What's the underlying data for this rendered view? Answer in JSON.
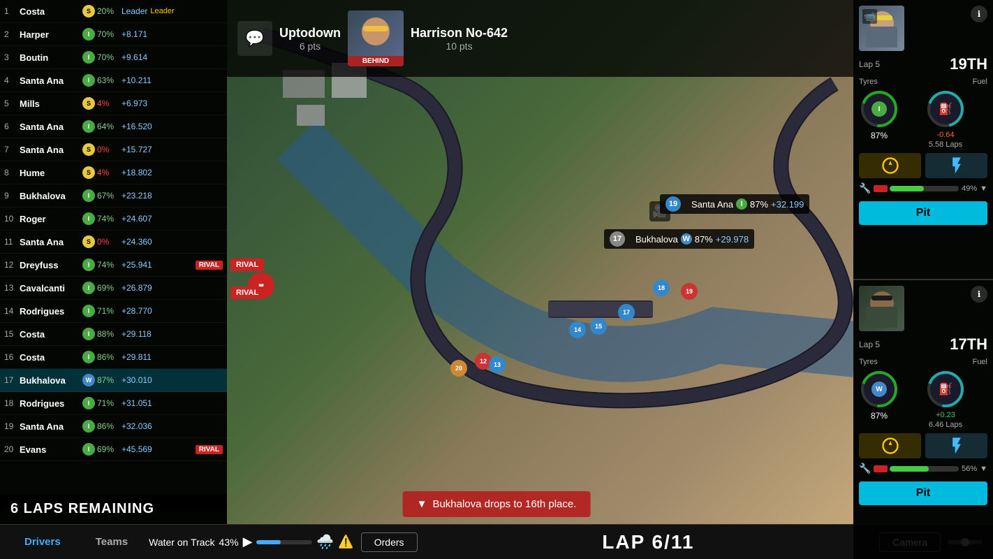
{
  "standings": [
    {
      "pos": 1,
      "name": "Costa",
      "tyre": "S",
      "pct": "20%",
      "gap": "Leader",
      "rival": false,
      "highlight": false
    },
    {
      "pos": 2,
      "name": "Harper",
      "tyre": "I",
      "pct": "70%",
      "gap": "+8.171",
      "rival": false,
      "highlight": false
    },
    {
      "pos": 3,
      "name": "Boutin",
      "tyre": "I",
      "pct": "70%",
      "gap": "+9.614",
      "rival": false,
      "highlight": false
    },
    {
      "pos": 4,
      "name": "Santa Ana",
      "tyre": "I",
      "pct": "63%",
      "gap": "+10.211",
      "rival": false,
      "highlight": false
    },
    {
      "pos": 5,
      "name": "Mills",
      "tyre": "S",
      "pct": "4%",
      "gap": "+6.973",
      "rival": false,
      "highlight": false
    },
    {
      "pos": 6,
      "name": "Santa Ana",
      "tyre": "I",
      "pct": "64%",
      "gap": "+16.520",
      "rival": false,
      "highlight": false
    },
    {
      "pos": 7,
      "name": "Santa Ana",
      "tyre": "S",
      "pct": "0%",
      "gap": "+15.727",
      "rival": false,
      "highlight": false
    },
    {
      "pos": 8,
      "name": "Hume",
      "tyre": "S",
      "pct": "4%",
      "gap": "+18.802",
      "rival": false,
      "highlight": false
    },
    {
      "pos": 9,
      "name": "Bukhalova",
      "tyre": "I",
      "pct": "67%",
      "gap": "+23.218",
      "rival": false,
      "highlight": false
    },
    {
      "pos": 10,
      "name": "Roger",
      "tyre": "I",
      "pct": "74%",
      "gap": "+24.607",
      "rival": false,
      "highlight": false
    },
    {
      "pos": 11,
      "name": "Santa Ana",
      "tyre": "S",
      "pct": "0%",
      "gap": "+24.360",
      "rival": false,
      "highlight": false
    },
    {
      "pos": 12,
      "name": "Dreyfuss",
      "tyre": "I",
      "pct": "74%",
      "gap": "+25.941",
      "rival": true,
      "highlight": false
    },
    {
      "pos": 13,
      "name": "Cavalcanti",
      "tyre": "I",
      "pct": "69%",
      "gap": "+26.879",
      "rival": false,
      "highlight": false
    },
    {
      "pos": 14,
      "name": "Rodrigues",
      "tyre": "I",
      "pct": "71%",
      "gap": "+28.770",
      "rival": false,
      "highlight": false
    },
    {
      "pos": 15,
      "name": "Costa",
      "tyre": "I",
      "pct": "88%",
      "gap": "+29.118",
      "rival": false,
      "highlight": false
    },
    {
      "pos": 16,
      "name": "Costa",
      "tyre": "I",
      "pct": "86%",
      "gap": "+29.811",
      "rival": false,
      "highlight": false
    },
    {
      "pos": 17,
      "name": "Bukhalova",
      "tyre": "W",
      "pct": "87%",
      "gap": "+30.010",
      "rival": false,
      "highlight": true
    },
    {
      "pos": 18,
      "name": "Rodrigues",
      "tyre": "I",
      "pct": "71%",
      "gap": "+31.051",
      "rival": false,
      "highlight": false
    },
    {
      "pos": 19,
      "name": "Santa Ana",
      "tyre": "I",
      "pct": "86%",
      "gap": "+32.036",
      "rival": false,
      "highlight": false
    },
    {
      "pos": 20,
      "name": "Evans",
      "tyre": "I",
      "pct": "69%",
      "gap": "+45.569",
      "rival": true,
      "highlight": false
    }
  ],
  "laps_remaining": "6 LAPS REMAINING",
  "top_bar": {
    "chat_icon": "💬",
    "uptodown_name": "Uptodown",
    "uptodown_pts": "6 pts",
    "behind_label": "BEHIND",
    "harrison_name": "Harrison No-642",
    "harrison_pts": "10 pts"
  },
  "map_labels": [
    {
      "num": 19,
      "name": "Santa Ana",
      "tyre": "I",
      "pct": "87%",
      "gap": "+32.199"
    },
    {
      "num": 17,
      "name": "Bukhalova",
      "tyre": "W",
      "pct": "87%",
      "gap": "+29.978"
    }
  ],
  "notification": {
    "icon": "▼",
    "text": "Bukhalova drops to 16th place."
  },
  "bottom_bar": {
    "tab_drivers": "Drivers",
    "tab_teams": "Teams",
    "water_label": "Water on Track",
    "water_pct": "43%",
    "water_fill": 43,
    "orders_label": "Orders",
    "lap_display": "LAP 6/11",
    "camera_label": "Camera"
  },
  "right_panel": {
    "driver1": {
      "lap": "Lap 5",
      "position": "19TH",
      "tyres_label": "Tyres",
      "fuel_label": "Fuel",
      "tyre_pct": "87%",
      "fuel_delta": "-0.64",
      "fuel_laps": "5.58 Laps",
      "repair_pct": "49%",
      "tyre_type": "I",
      "pit_label": "Pit"
    },
    "driver2": {
      "lap": "Lap 5",
      "position": "17TH",
      "tyres_label": "Tyres",
      "fuel_label": "Fuel",
      "tyre_pct": "87%",
      "fuel_delta": "+0.23",
      "fuel_laps": "6.46 Laps",
      "repair_pct": "56%",
      "tyre_type": "W",
      "pit_label": "Pit"
    }
  },
  "rival_badges": [
    "RIVAL",
    "RIVAL",
    "RIVAL"
  ]
}
